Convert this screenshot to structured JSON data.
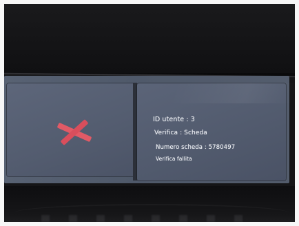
{
  "screen": {
    "status_icon": "x-mark-icon",
    "status_color": "#e25a66",
    "info_lines": [
      "ID utente : 3",
      "Verifica : Scheda",
      "Numero scheda : 5780497",
      "Verifica fallita"
    ]
  }
}
